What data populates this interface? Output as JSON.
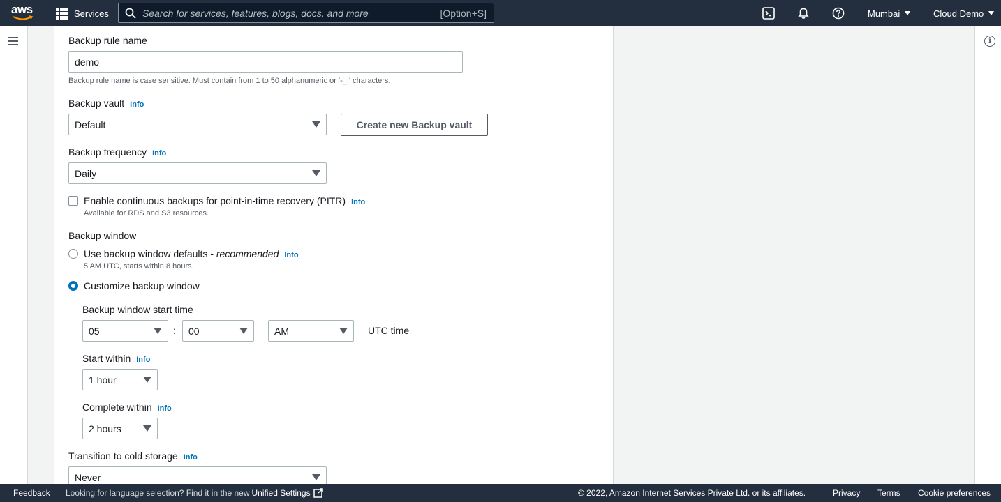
{
  "topnav": {
    "logo": "aws",
    "services_label": "Services",
    "search_placeholder": "Search for services, features, blogs, docs, and more",
    "search_shortcut": "[Option+S]",
    "region": "Mumbai",
    "account": "Cloud Demo"
  },
  "form": {
    "rule_name": {
      "label": "Backup rule name",
      "value": "demo",
      "help": "Backup rule name is case sensitive. Must contain from 1 to 50 alphanumeric or '-_.' characters."
    },
    "vault": {
      "label": "Backup vault",
      "info": "Info",
      "value": "Default",
      "create_button": "Create new Backup vault"
    },
    "frequency": {
      "label": "Backup frequency",
      "info": "Info",
      "value": "Daily"
    },
    "pitr": {
      "label": "Enable continuous backups for point-in-time recovery (PITR)",
      "info": "Info",
      "help": "Available for RDS and S3 resources.",
      "checked": false
    },
    "window": {
      "label": "Backup window",
      "default_option": "Use backup window defaults - ",
      "default_option_em": "recommended",
      "default_info": "Info",
      "default_help": "5 AM UTC, starts within 8 hours.",
      "custom_option": "Customize backup window",
      "selected": "custom",
      "start_time_label": "Backup window start time",
      "hour": "05",
      "separator": ":",
      "minute": "00",
      "ampm": "AM",
      "tz": "UTC time",
      "start_within_label": "Start within",
      "start_within_info": "Info",
      "start_within": "1 hour",
      "complete_within_label": "Complete within",
      "complete_within_info": "Info",
      "complete_within": "2 hours"
    },
    "cold_storage": {
      "label": "Transition to cold storage",
      "info": "Info",
      "value": "Never"
    }
  },
  "footer": {
    "feedback": "Feedback",
    "lang_notice": "Looking for language selection? Find it in the new ",
    "unified_settings": "Unified Settings",
    "copyright": "© 2022, Amazon Internet Services Private Ltd. or its affiliates.",
    "privacy": "Privacy",
    "terms": "Terms",
    "cookies": "Cookie preferences"
  },
  "colors": {
    "nav_bg": "#232f3e",
    "link": "#0073bb",
    "accent": "#ff9900"
  }
}
